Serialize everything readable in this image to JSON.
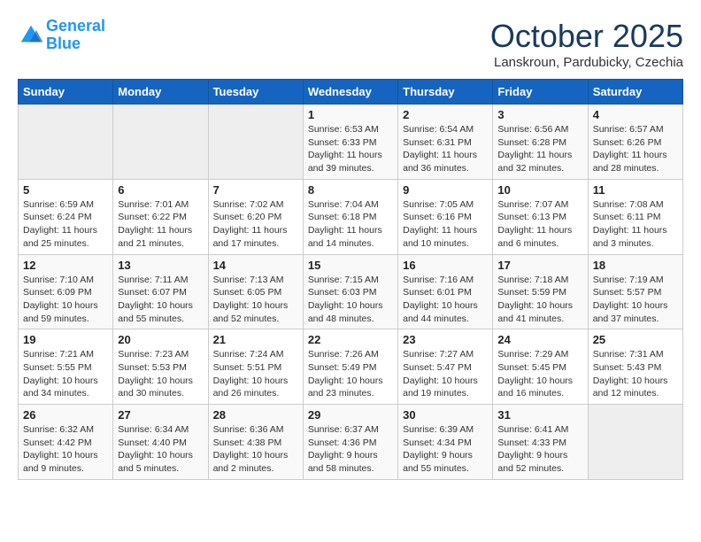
{
  "header": {
    "logo_line1": "General",
    "logo_line2": "Blue",
    "month": "October 2025",
    "location": "Lanskroun, Pardubicky, Czechia"
  },
  "days_of_week": [
    "Sunday",
    "Monday",
    "Tuesday",
    "Wednesday",
    "Thursday",
    "Friday",
    "Saturday"
  ],
  "weeks": [
    [
      {
        "day": "",
        "info": ""
      },
      {
        "day": "",
        "info": ""
      },
      {
        "day": "",
        "info": ""
      },
      {
        "day": "1",
        "info": "Sunrise: 6:53 AM\nSunset: 6:33 PM\nDaylight: 11 hours\nand 39 minutes."
      },
      {
        "day": "2",
        "info": "Sunrise: 6:54 AM\nSunset: 6:31 PM\nDaylight: 11 hours\nand 36 minutes."
      },
      {
        "day": "3",
        "info": "Sunrise: 6:56 AM\nSunset: 6:28 PM\nDaylight: 11 hours\nand 32 minutes."
      },
      {
        "day": "4",
        "info": "Sunrise: 6:57 AM\nSunset: 6:26 PM\nDaylight: 11 hours\nand 28 minutes."
      }
    ],
    [
      {
        "day": "5",
        "info": "Sunrise: 6:59 AM\nSunset: 6:24 PM\nDaylight: 11 hours\nand 25 minutes."
      },
      {
        "day": "6",
        "info": "Sunrise: 7:01 AM\nSunset: 6:22 PM\nDaylight: 11 hours\nand 21 minutes."
      },
      {
        "day": "7",
        "info": "Sunrise: 7:02 AM\nSunset: 6:20 PM\nDaylight: 11 hours\nand 17 minutes."
      },
      {
        "day": "8",
        "info": "Sunrise: 7:04 AM\nSunset: 6:18 PM\nDaylight: 11 hours\nand 14 minutes."
      },
      {
        "day": "9",
        "info": "Sunrise: 7:05 AM\nSunset: 6:16 PM\nDaylight: 11 hours\nand 10 minutes."
      },
      {
        "day": "10",
        "info": "Sunrise: 7:07 AM\nSunset: 6:13 PM\nDaylight: 11 hours\nand 6 minutes."
      },
      {
        "day": "11",
        "info": "Sunrise: 7:08 AM\nSunset: 6:11 PM\nDaylight: 11 hours\nand 3 minutes."
      }
    ],
    [
      {
        "day": "12",
        "info": "Sunrise: 7:10 AM\nSunset: 6:09 PM\nDaylight: 10 hours\nand 59 minutes."
      },
      {
        "day": "13",
        "info": "Sunrise: 7:11 AM\nSunset: 6:07 PM\nDaylight: 10 hours\nand 55 minutes."
      },
      {
        "day": "14",
        "info": "Sunrise: 7:13 AM\nSunset: 6:05 PM\nDaylight: 10 hours\nand 52 minutes."
      },
      {
        "day": "15",
        "info": "Sunrise: 7:15 AM\nSunset: 6:03 PM\nDaylight: 10 hours\nand 48 minutes."
      },
      {
        "day": "16",
        "info": "Sunrise: 7:16 AM\nSunset: 6:01 PM\nDaylight: 10 hours\nand 44 minutes."
      },
      {
        "day": "17",
        "info": "Sunrise: 7:18 AM\nSunset: 5:59 PM\nDaylight: 10 hours\nand 41 minutes."
      },
      {
        "day": "18",
        "info": "Sunrise: 7:19 AM\nSunset: 5:57 PM\nDaylight: 10 hours\nand 37 minutes."
      }
    ],
    [
      {
        "day": "19",
        "info": "Sunrise: 7:21 AM\nSunset: 5:55 PM\nDaylight: 10 hours\nand 34 minutes."
      },
      {
        "day": "20",
        "info": "Sunrise: 7:23 AM\nSunset: 5:53 PM\nDaylight: 10 hours\nand 30 minutes."
      },
      {
        "day": "21",
        "info": "Sunrise: 7:24 AM\nSunset: 5:51 PM\nDaylight: 10 hours\nand 26 minutes."
      },
      {
        "day": "22",
        "info": "Sunrise: 7:26 AM\nSunset: 5:49 PM\nDaylight: 10 hours\nand 23 minutes."
      },
      {
        "day": "23",
        "info": "Sunrise: 7:27 AM\nSunset: 5:47 PM\nDaylight: 10 hours\nand 19 minutes."
      },
      {
        "day": "24",
        "info": "Sunrise: 7:29 AM\nSunset: 5:45 PM\nDaylight: 10 hours\nand 16 minutes."
      },
      {
        "day": "25",
        "info": "Sunrise: 7:31 AM\nSunset: 5:43 PM\nDaylight: 10 hours\nand 12 minutes."
      }
    ],
    [
      {
        "day": "26",
        "info": "Sunrise: 6:32 AM\nSunset: 4:42 PM\nDaylight: 10 hours\nand 9 minutes."
      },
      {
        "day": "27",
        "info": "Sunrise: 6:34 AM\nSunset: 4:40 PM\nDaylight: 10 hours\nand 5 minutes."
      },
      {
        "day": "28",
        "info": "Sunrise: 6:36 AM\nSunset: 4:38 PM\nDaylight: 10 hours\nand 2 minutes."
      },
      {
        "day": "29",
        "info": "Sunrise: 6:37 AM\nSunset: 4:36 PM\nDaylight: 9 hours\nand 58 minutes."
      },
      {
        "day": "30",
        "info": "Sunrise: 6:39 AM\nSunset: 4:34 PM\nDaylight: 9 hours\nand 55 minutes."
      },
      {
        "day": "31",
        "info": "Sunrise: 6:41 AM\nSunset: 4:33 PM\nDaylight: 9 hours\nand 52 minutes."
      },
      {
        "day": "",
        "info": ""
      }
    ]
  ]
}
